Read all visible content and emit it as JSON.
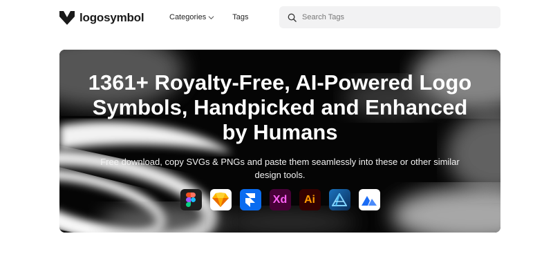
{
  "header": {
    "logo_text": "logosymbol",
    "logo_icon": "logosymbol-mark-icon",
    "nav": [
      {
        "label": "Categories",
        "has_dropdown": true
      },
      {
        "label": "Tags",
        "has_dropdown": false
      }
    ],
    "search": {
      "placeholder": "Search Tags",
      "value": "",
      "icon": "search-icon"
    }
  },
  "hero": {
    "title_lines": [
      "1361+ Royalty-Free, AI-Powered Logo",
      "Symbols, Handpicked and Enhanced",
      "by Humans"
    ],
    "subtitle_lines": [
      "Free download, copy SVGs & PNGs and paste them seamlessly into these or other similar",
      "design tools."
    ],
    "tools": [
      {
        "name": "figma",
        "icon": "figma-icon",
        "bg": "#1e1e1e"
      },
      {
        "name": "sketch",
        "icon": "sketch-icon",
        "bg": "#ffffff"
      },
      {
        "name": "framer",
        "icon": "framer-icon",
        "bg": "#0a6cf0"
      },
      {
        "name": "xd",
        "icon": "adobe-xd-icon",
        "label": "Xd",
        "bg": "#470137",
        "fg": "#ff61f6"
      },
      {
        "name": "illustrator",
        "icon": "adobe-illustrator-icon",
        "label": "Ai",
        "bg": "#330000",
        "fg": "#ff9a00"
      },
      {
        "name": "affinity",
        "icon": "affinity-designer-icon",
        "bg": "#134881"
      },
      {
        "name": "vectornator",
        "icon": "vectornator-icon",
        "bg": "#ffffff"
      }
    ]
  },
  "colors": {
    "page_bg": "#ffffff",
    "search_bg": "#f2f2f3",
    "hero_text": "#ffffff"
  }
}
